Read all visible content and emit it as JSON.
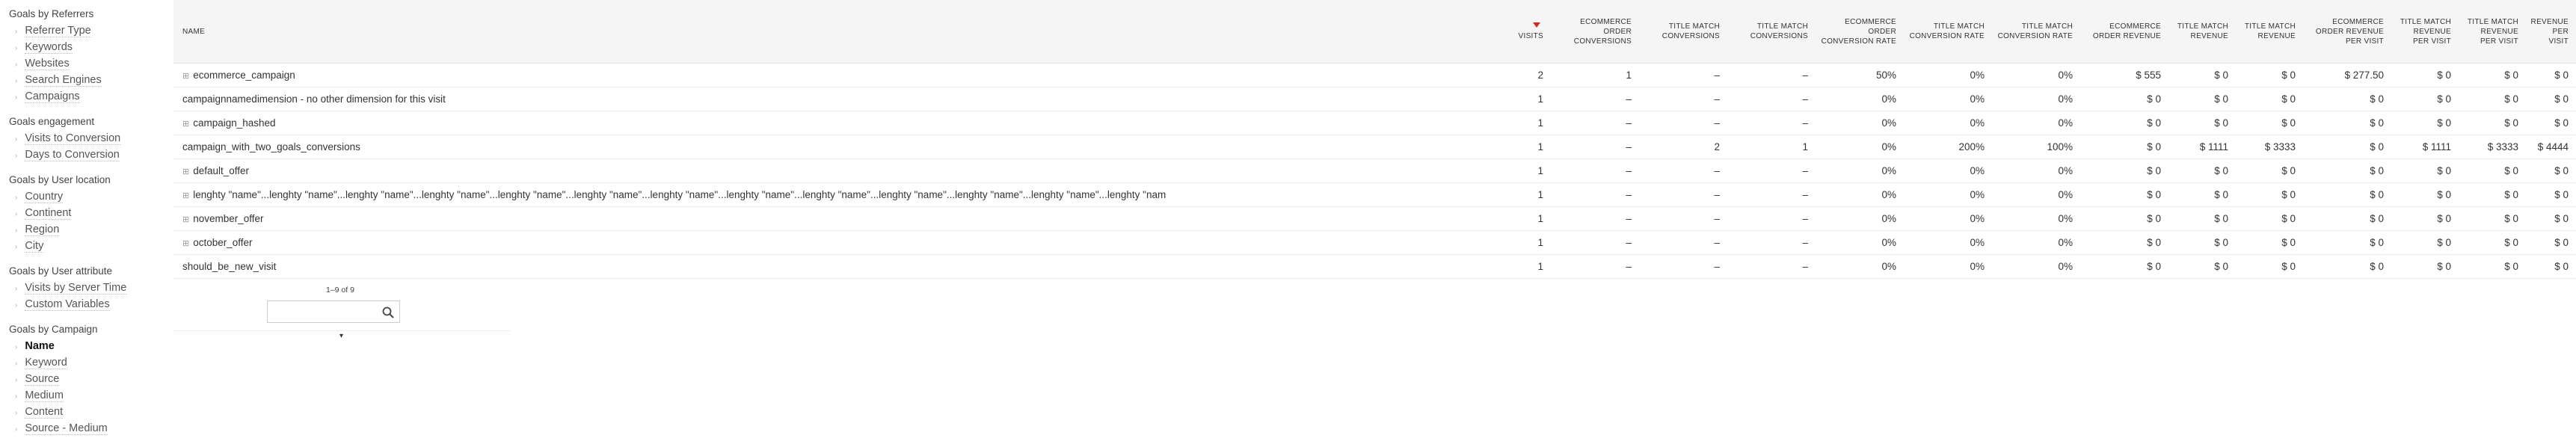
{
  "sidebar": {
    "groups": [
      {
        "title": "Goals by Referrers",
        "items": [
          "Referrer Type",
          "Keywords",
          "Websites",
          "Search Engines",
          "Campaigns"
        ]
      },
      {
        "title": "Goals engagement",
        "items": [
          "Visits to Conversion",
          "Days to Conversion"
        ]
      },
      {
        "title": "Goals by User location",
        "items": [
          "Country",
          "Continent",
          "Region",
          "City"
        ]
      },
      {
        "title": "Goals by User attribute",
        "items": [
          "Visits by Server Time",
          "Custom Variables"
        ]
      },
      {
        "title": "Goals by Campaign",
        "items": [
          "Name",
          "Keyword",
          "Source",
          "Medium",
          "Content",
          "Source - Medium"
        ],
        "active": "Name"
      }
    ]
  },
  "table": {
    "headers": {
      "name": "NAME",
      "visits": "VISITS",
      "ecommerce_order_conversions": "ECOMMERCE ORDER CONVERSIONS",
      "title_match_conversions_1": "TITLE MATCH CONVERSIONS",
      "title_match_conversions_2": "TITLE MATCH CONVERSIONS",
      "ecommerce_order_conversion_rate": "ECOMMERCE ORDER CONVERSION RATE",
      "title_match_conversion_rate_1": "TITLE MATCH CONVERSION RATE",
      "title_match_conversion_rate_2": "TITLE MATCH CONVERSION RATE",
      "ecommerce_order_revenue": "ECOMMERCE ORDER REVENUE",
      "title_match_revenue_1": "TITLE MATCH REVENUE",
      "title_match_revenue_2": "TITLE MATCH REVENUE",
      "ecommerce_order_revenue_per_visit": "ECOMMERCE ORDER REVENUE PER VISIT",
      "title_match_revenue_per_visit_1": "TITLE MATCH REVENUE PER VISIT",
      "title_match_revenue_per_visit_2": "TITLE MATCH REVENUE PER VISIT",
      "revenue_per_visit": "REVENUE PER VISIT"
    },
    "rows": [
      {
        "expandable": true,
        "name": "ecommerce_campaign",
        "cells": [
          "2",
          "1",
          "–",
          "–",
          "50%",
          "0%",
          "0%",
          "$ 555",
          "$ 0",
          "$ 0",
          "$ 277.50",
          "$ 0",
          "$ 0",
          "$ 0"
        ]
      },
      {
        "expandable": false,
        "name": "campaignnamedimension - no other dimension for this visit",
        "cells": [
          "1",
          "–",
          "–",
          "–",
          "0%",
          "0%",
          "0%",
          "$ 0",
          "$ 0",
          "$ 0",
          "$ 0",
          "$ 0",
          "$ 0",
          "$ 0"
        ]
      },
      {
        "expandable": true,
        "name": "campaign_hashed",
        "cells": [
          "1",
          "–",
          "–",
          "–",
          "0%",
          "0%",
          "0%",
          "$ 0",
          "$ 0",
          "$ 0",
          "$ 0",
          "$ 0",
          "$ 0",
          "$ 0"
        ]
      },
      {
        "expandable": false,
        "name": "campaign_with_two_goals_conversions",
        "cells": [
          "1",
          "–",
          "2",
          "1",
          "0%",
          "200%",
          "100%",
          "$ 0",
          "$ 1111",
          "$ 3333",
          "$ 0",
          "$ 1111",
          "$ 3333",
          "$ 4444"
        ]
      },
      {
        "expandable": true,
        "name": "default_offer",
        "cells": [
          "1",
          "–",
          "–",
          "–",
          "0%",
          "0%",
          "0%",
          "$ 0",
          "$ 0",
          "$ 0",
          "$ 0",
          "$ 0",
          "$ 0",
          "$ 0"
        ]
      },
      {
        "expandable": true,
        "name": "lenghty \"name\"...lenghty \"name\"...lenghty \"name\"...lenghty \"name\"...lenghty \"name\"...lenghty \"name\"...lenghty \"name\"...lenghty \"name\"...lenghty \"name\"...lenghty \"name\"...lenghty \"name\"...lenghty \"name\"...lenghty \"nam",
        "cells": [
          "1",
          "–",
          "–",
          "–",
          "0%",
          "0%",
          "0%",
          "$ 0",
          "$ 0",
          "$ 0",
          "$ 0",
          "$ 0",
          "$ 0",
          "$ 0"
        ]
      },
      {
        "expandable": true,
        "name": "november_offer",
        "cells": [
          "1",
          "–",
          "–",
          "–",
          "0%",
          "0%",
          "0%",
          "$ 0",
          "$ 0",
          "$ 0",
          "$ 0",
          "$ 0",
          "$ 0",
          "$ 0"
        ]
      },
      {
        "expandable": true,
        "name": "october_offer",
        "cells": [
          "1",
          "–",
          "–",
          "–",
          "0%",
          "0%",
          "0%",
          "$ 0",
          "$ 0",
          "$ 0",
          "$ 0",
          "$ 0",
          "$ 0",
          "$ 0"
        ]
      },
      {
        "expandable": false,
        "name": "should_be_new_visit",
        "cells": [
          "1",
          "–",
          "–",
          "–",
          "0%",
          "0%",
          "0%",
          "$ 0",
          "$ 0",
          "$ 0",
          "$ 0",
          "$ 0",
          "$ 0",
          "$ 0"
        ]
      }
    ]
  },
  "pagination": {
    "count_label": "1–9 of 9",
    "search_value": "",
    "limit_value": ""
  },
  "icons": {
    "expand": "plus-square-icon",
    "search": "magnifier-icon",
    "sort": "sort-desc-icon"
  },
  "colors": {
    "sort_arrow": "#d4291f",
    "header_bg": "#f5f5f5"
  }
}
